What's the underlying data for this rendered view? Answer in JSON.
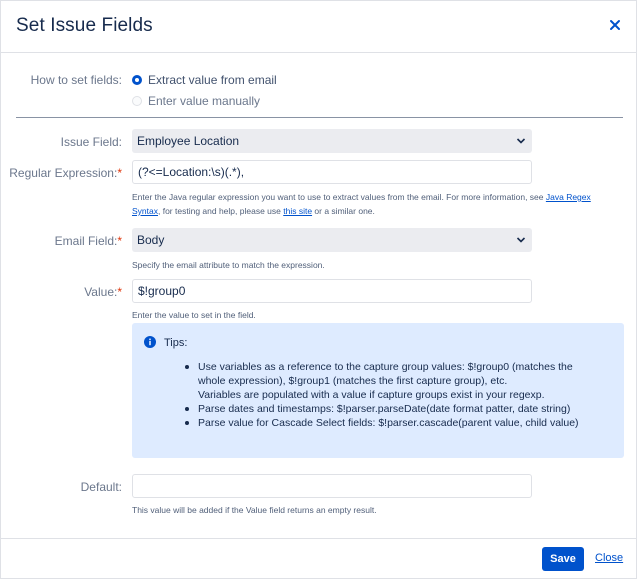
{
  "dialog": {
    "title": "Set Issue Fields",
    "close_icon": "close-icon"
  },
  "how_to_set": {
    "label": "How to set fields:",
    "options": [
      {
        "label": "Extract value from email",
        "selected": true
      },
      {
        "label": "Enter value manually",
        "selected": false
      }
    ]
  },
  "issue_field": {
    "label": "Issue Field:",
    "value": "Employee Location"
  },
  "regex": {
    "label": "Regular Expression:",
    "required_mark": "*",
    "value": "(?<=Location:\\s)(.*),",
    "help_part1": "Enter the Java regular expression you want to use to extract values from the email. For more information, see ",
    "help_link1": "Java Regex Syntax",
    "help_part2": ", for testing and help, please use ",
    "help_link2": "this site",
    "help_part3": " or a similar one."
  },
  "email_field": {
    "label": "Email Field:",
    "required_mark": "*",
    "value": "Body",
    "help": "Specify the email attribute to match the expression."
  },
  "value_field": {
    "label": "Value:",
    "required_mark": "*",
    "value": "$!group0",
    "help": "Enter the value to set in the field."
  },
  "tips": {
    "title": "Tips:",
    "icon": "info-icon",
    "items": [
      {
        "line1": "Use variables as a reference to the capture group values: $!group0 (matches the whole expression), $!group1 (matches the first capture group), etc.",
        "line2": "Variables are populated with a value if capture groups exist in your regexp."
      },
      {
        "line1": "Parse dates and timestamps: $!parser.parseDate(date format patter, date string)"
      },
      {
        "line1": "Parse value for Cascade Select fields: $!parser.cascade(parent value, child value)"
      }
    ]
  },
  "default_field": {
    "label": "Default:",
    "value": "",
    "help": "This value will be added if the Value field returns an empty result."
  },
  "footer": {
    "save_label": "Save",
    "close_label": "Close"
  },
  "colors": {
    "accent": "#0052cc",
    "required": "#de350b",
    "tips_bg": "#deebff"
  }
}
